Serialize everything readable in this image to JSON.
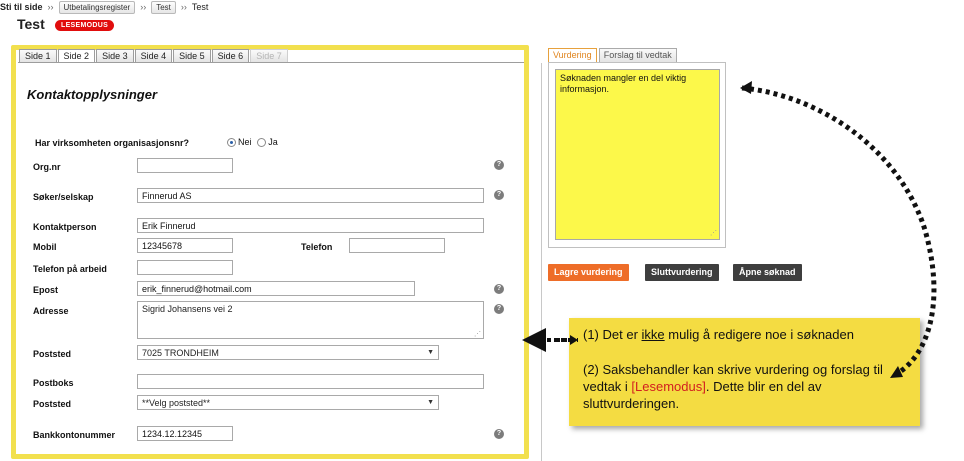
{
  "breadcrumb": {
    "root": "Sti til side",
    "sep": "››",
    "item1": "Utbetalingsregister",
    "item2": "Test",
    "current": "Test"
  },
  "page": {
    "title": "Test",
    "badge": "LESEMODUS"
  },
  "tabs": [
    {
      "label": "Side 1",
      "state": "normal"
    },
    {
      "label": "Side 2",
      "state": "active"
    },
    {
      "label": "Side 3",
      "state": "normal"
    },
    {
      "label": "Side 4",
      "state": "normal"
    },
    {
      "label": "Side 5",
      "state": "normal"
    },
    {
      "label": "Side 6",
      "state": "normal"
    },
    {
      "label": "Side 7",
      "state": "disabled"
    }
  ],
  "form": {
    "heading": "Kontaktopplysninger",
    "org_question": "Har virksomheten organisasjonsnr?",
    "radio_no": "Nei",
    "radio_yes": "Ja",
    "selected_radio": "Nei",
    "orgnr_label": "Org.nr",
    "orgnr_value": "",
    "soker_label": "Søker/selskap",
    "soker_value": "Finnerud AS",
    "kontakt_label": "Kontaktperson",
    "kontakt_value": "Erik Finnerud",
    "mobil_label": "Mobil",
    "mobil_value": "12345678",
    "telefon_label": "Telefon",
    "telefon_value": "",
    "tlfarbeid_label": "Telefon på arbeid",
    "tlfarbeid_value": "",
    "epost_label": "Epost",
    "epost_value": "erik_finnerud@hotmail.com",
    "adresse_label": "Adresse",
    "adresse_value": "Sigrid Johansens vei 2",
    "poststed_label": "Poststed",
    "poststed_value": "7025 TRONDHEIM",
    "postboks_label": "Postboks",
    "postboks_value": "",
    "poststed2_label": "Poststed",
    "poststed2_value": "**Velg poststed**",
    "bank_label": "Bankkontonummer",
    "bank_value": "1234.12.12345",
    "help_glyph": "?"
  },
  "right": {
    "tab_vurdering": "Vurdering",
    "tab_forslag": "Forslag til vedtak",
    "note": "Søknaden mangler en del viktig informasjon.",
    "btn_save": "Lagre vurdering",
    "btn_final": "Sluttvurdering",
    "btn_open": "Åpne søknad"
  },
  "callout": {
    "line1_pre": "(1) Det er ",
    "line1_u": "ikke",
    "line1_post": " mulig å redigere noe i søknaden",
    "line2_pre": "(2) Saksbehandler kan skrive vurdering og forslag til vedtak i ",
    "line2_red": "[Lesemodus]",
    "line2_post": ". Dette blir en del av sluttvurderingen."
  },
  "colors": {
    "highlight_frame": "#f2e04e",
    "note_bg": "#fcf84a",
    "callout_bg": "#f4dc42",
    "badge_red": "#e10d0d",
    "save_orange": "#ee6d28",
    "dark_button": "#3e3e3e"
  },
  "icons": [
    "help-icon",
    "dotted-arrow-icon",
    "dropdown-arrow-icon",
    "resize-grip-icon"
  ]
}
